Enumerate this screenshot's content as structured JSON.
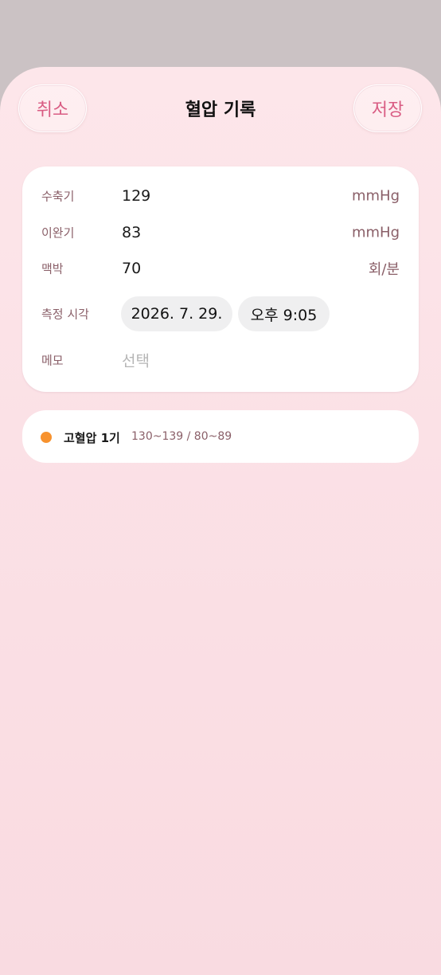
{
  "header": {
    "cancel_label": "취소",
    "title": "혈압 기록",
    "save_label": "저장"
  },
  "form": {
    "systolic": {
      "label": "수축기",
      "value": "129",
      "unit": "mmHg"
    },
    "diastolic": {
      "label": "이완기",
      "value": "83",
      "unit": "mmHg"
    },
    "pulse": {
      "label": "맥박",
      "value": "70",
      "unit": "회/분"
    },
    "measured_at": {
      "label": "측정 시각",
      "date": "2026. 7. 29.",
      "time": "오후 9:05"
    },
    "memo": {
      "label": "메모",
      "placeholder": "선택"
    }
  },
  "category": {
    "name": "고혈압 1기",
    "range": "130~139 / 80~89",
    "color": "#f7922e"
  },
  "colors": {
    "accent": "#d95c83",
    "label": "#8a5f68"
  }
}
